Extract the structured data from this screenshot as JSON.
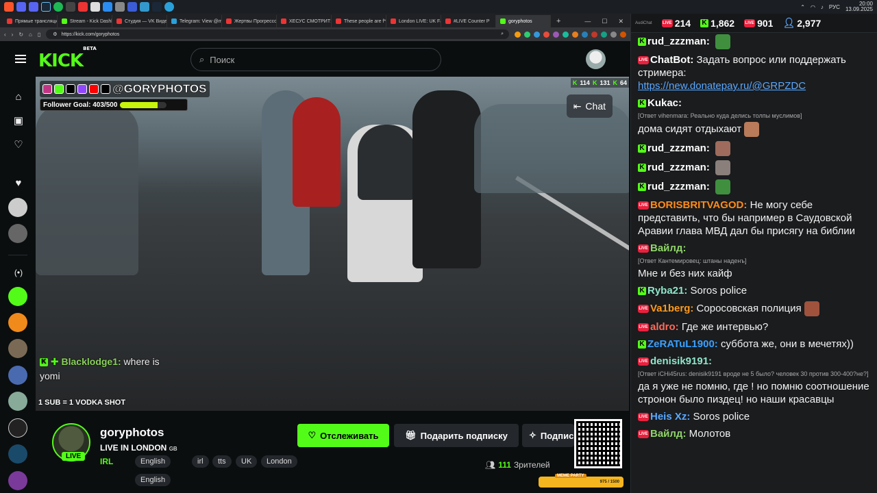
{
  "taskbar": {
    "time": "20:00",
    "date": "13.09.2025",
    "lang": "РУС"
  },
  "browser": {
    "tabs": [
      {
        "title": "Прямые трансляции",
        "color": "#e33"
      },
      {
        "title": "Stream - Kick Dashb",
        "color": "#53fc18"
      },
      {
        "title": "Студия — VK Видео",
        "color": "#e33"
      },
      {
        "title": "Telegram: View @m",
        "color": "#29a0da"
      },
      {
        "title": "Жертвы Прогрессо",
        "color": "#e33"
      },
      {
        "title": "ХЕСУС СМОТРИТ: У",
        "color": "#e33"
      },
      {
        "title": "These people are f*c",
        "color": "#e33"
      },
      {
        "title": "London LIVE: UK Fa",
        "color": "#e33"
      },
      {
        "title": "#LIVE Counter P",
        "color": "#e33"
      },
      {
        "title": "goryphotos",
        "color": "#53fc18"
      }
    ],
    "new_tab": "+",
    "url": "https://kick.com/goryphotos"
  },
  "kick": {
    "logo": "KICK",
    "logo_sup": "BETA",
    "search_placeholder": "Поиск"
  },
  "video": {
    "handle": "@GORYPHOTOS",
    "goal_label": "Follower Goal: 403/500",
    "goal_progress": 0.806,
    "stats": {
      "kicks": "114",
      "follows": "131",
      "views": "64"
    },
    "chat_button": "Chat",
    "overlay_user": "Blacklodge1:",
    "overlay_text_1": "where is",
    "overlay_text_2": "yomi",
    "sub_promo": "1 SUB = 1 VODKA SHOT"
  },
  "streamer": {
    "name": "goryphotos",
    "live_badge": "LIVE",
    "title": "LIVE IN LONDON",
    "country": "GB",
    "category": "IRL",
    "tags": [
      "English",
      "irl",
      "tts",
      "UK",
      "London",
      "English"
    ],
    "follow_label": "Отслеживать",
    "gift_label": "Подарить подписку",
    "subscribe_label": "Подпис",
    "viewers_count": "111",
    "viewers_label": "Зрителей",
    "meme_party": "MEME PARTY",
    "meme_progress": "975 / 1500"
  },
  "chat_stats": {
    "label": "AudiChat",
    "live": "214",
    "kick": "1,862",
    "vk": "901",
    "users": "2,977"
  },
  "chat": [
    {
      "platform": "kick",
      "user": "rud_zzzman:",
      "color": "#fff",
      "text": "",
      "emote": "#3f8f3f"
    },
    {
      "platform": "live",
      "user": "ChatBot:",
      "color": "#fff",
      "text": "Задать вопрос или поддержать стримера:",
      "link": "https://new.donatepay.ru/@GRPZDC"
    },
    {
      "platform": "kick",
      "user": "Kukac:",
      "color": "#fff",
      "reply": "[Ответ vihenmara: Реально куда делись толпы муслимов]",
      "text": "дома сидят отдыхают",
      "emote": "#b97b5a"
    },
    {
      "platform": "kick",
      "user": "rud_zzzman:",
      "color": "#fff",
      "text": "",
      "emote": "#9e6b5c"
    },
    {
      "platform": "kick",
      "user": "rud_zzzman:",
      "color": "#fff",
      "text": "",
      "emote": "#8a7f7a"
    },
    {
      "platform": "kick",
      "user": "rud_zzzman:",
      "color": "#fff",
      "text": "",
      "emote": "#3f8f3f"
    },
    {
      "platform": "live",
      "user": "BORISBRITVAGOD:",
      "color": "#ff8c1a",
      "text": "Не могу себе представить, что бы например в Саудовской Аравии глава МВД дал бы присягу на библии"
    },
    {
      "platform": "live",
      "user": "Вайлд:",
      "color": "#8fd468",
      "reply": "[Ответ Кантемировец: штаны наденъ]",
      "text": "Мне и без них кайф"
    },
    {
      "platform": "kick",
      "user": "Ryba21:",
      "color": "#8fe6c8",
      "text": "Soros police"
    },
    {
      "platform": "live",
      "user": "Va1berg:",
      "color": "#ff9a1a",
      "text": "Соросовская полиция",
      "emote": "#a0523d"
    },
    {
      "platform": "live",
      "user": "aldro:",
      "color": "#ff6a5a",
      "text": "Где же интервью?"
    },
    {
      "platform": "kick",
      "user": "ZeRATuL1900:",
      "color": "#3aa0ff",
      "text": "суббота же, они в мечетях))"
    },
    {
      "platform": "live",
      "user": "denisik9191:",
      "color": "#8fe6c8",
      "reply": "[Ответ iCHi45rus: denisik9191 вроде не 5 было? человек 30 против 300-400?не?]",
      "text": "да я уже не помню, где ! но помню соотношение стронон было пиздец! но наши красавцы"
    },
    {
      "platform": "live",
      "user": "Heis Xz:",
      "color": "#5aa8ff",
      "text": "Soros police"
    },
    {
      "platform": "live",
      "user": "Вайлд:",
      "color": "#8fd468",
      "text": "Молотов"
    }
  ]
}
